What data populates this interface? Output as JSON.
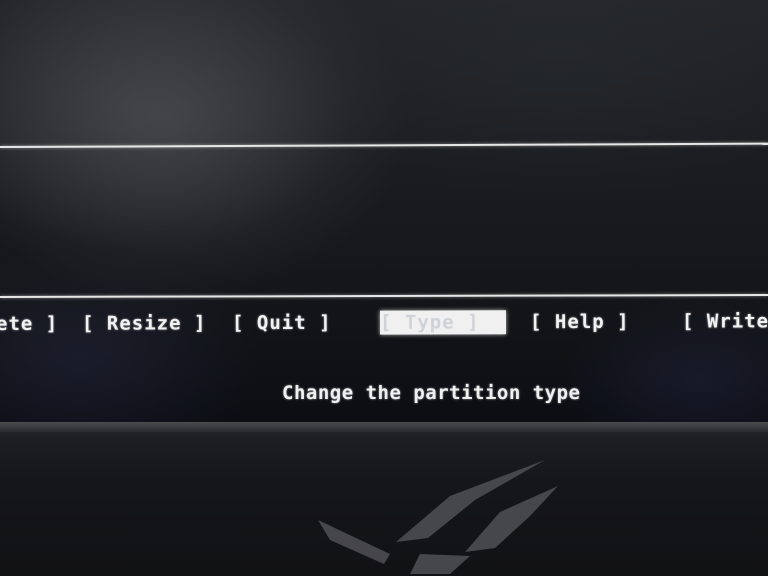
{
  "menu": {
    "items": [
      {
        "key": "delete",
        "label": "ete ]"
      },
      {
        "key": "resize",
        "label": "[ Resize ]"
      },
      {
        "key": "quit",
        "label": "[  Quit  ]"
      },
      {
        "key": "type",
        "label": "[  Type  ]",
        "selected": true
      },
      {
        "key": "help",
        "label": "[  Help  ]"
      },
      {
        "key": "write",
        "label": "[  Write"
      }
    ]
  },
  "status": {
    "hint": "Change the partition type"
  },
  "colors": {
    "text": "#f2f2f2",
    "selection_bg": "#f0f0f0",
    "background": "#0c0e14"
  },
  "icons": {
    "bezel_logo": "rog-logo-icon"
  }
}
